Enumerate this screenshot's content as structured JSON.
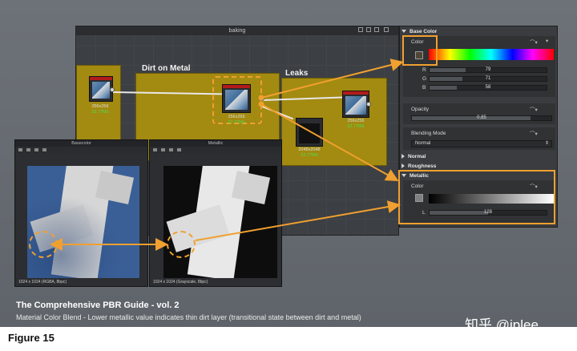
{
  "graph": {
    "title": "baking",
    "frames": [
      {
        "label": "Dirt on Metal"
      },
      {
        "label": "Leaks"
      }
    ],
    "nodes": [
      {
        "size": "256x256",
        "bits": "32.77Mb"
      },
      {
        "size": "256x256",
        "bits": "32.77Mb"
      },
      {
        "size": "2048x2048",
        "bits": "32.77Mb"
      },
      {
        "size": "256x256",
        "bits": "32.77Mb"
      }
    ]
  },
  "properties": {
    "base_color": {
      "header": "Base Color",
      "color_label": "Color",
      "swatch_color": "#4f4736",
      "channels": [
        {
          "label": "R",
          "value": "79",
          "fraction": 0.31
        },
        {
          "label": "G",
          "value": "71",
          "fraction": 0.28
        },
        {
          "label": "B",
          "value": "58",
          "fraction": 0.23
        }
      ]
    },
    "opacity": {
      "label": "Opacity",
      "value": "0.85",
      "fraction": 0.85
    },
    "blending": {
      "label": "Blending Mode",
      "value": "Normal"
    },
    "collapsed": [
      {
        "label": "Normal"
      },
      {
        "label": "Roughness"
      }
    ],
    "metallic": {
      "header": "Metallic",
      "color_label": "Color",
      "swatch_color": "#808080",
      "l_label": "L",
      "l_value": "128",
      "fraction": 0.5
    }
  },
  "viewers": [
    {
      "title": "Basecolor",
      "footer": "1024 x 1024 (RGBA, 8bpc)"
    },
    {
      "title": "Metallic",
      "footer": "1024 x 1024 (Grayscale, 8bpc)"
    }
  ],
  "caption": {
    "title": "The Comprehensive PBR Guide - vol. 2",
    "subtitle": "Material Color Blend - Lower metallic value indicates thin dirt layer (transitional state between dirt and metal)"
  },
  "watermark": "知乎 @jplee",
  "figure_label": "Figure 15",
  "colors": {
    "accent": "#f0a030",
    "frame": "#a38a10",
    "node_header": "#b21b1b",
    "size_text": "#4dde4d"
  }
}
